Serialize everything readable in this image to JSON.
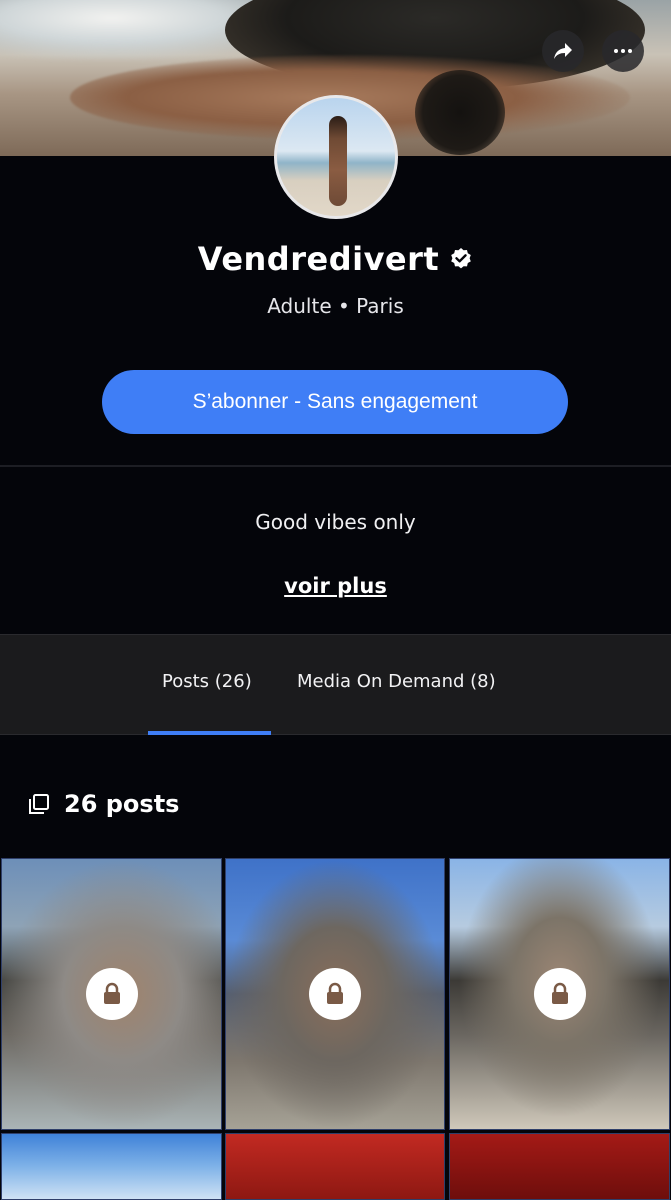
{
  "header": {
    "share_icon": "share-arrow-icon",
    "more_icon": "more-dots-icon"
  },
  "profile": {
    "name": "Vendredivert",
    "verified_icon": "verified-badge-icon",
    "subtitle": "Adulte • Paris",
    "subscribe_label": "S’abonner - Sans engagement",
    "bio": "Good vibes only",
    "see_more_label": "voir plus"
  },
  "tabs": [
    {
      "label": "Posts (26)",
      "active": true
    },
    {
      "label": "Media On Demand (8)",
      "active": false
    }
  ],
  "posts_count_label": "26 posts",
  "posts_icon": "stack-icon",
  "colors": {
    "accent": "#3f7ef6",
    "background": "#04050a",
    "tab_bar": "#1b1b1d"
  },
  "grid": {
    "lock_icon": "lock-icon",
    "tiles": [
      {
        "locked": true
      },
      {
        "locked": true
      },
      {
        "locked": true
      },
      {
        "locked": false
      },
      {
        "locked": false
      },
      {
        "locked": false
      }
    ]
  }
}
